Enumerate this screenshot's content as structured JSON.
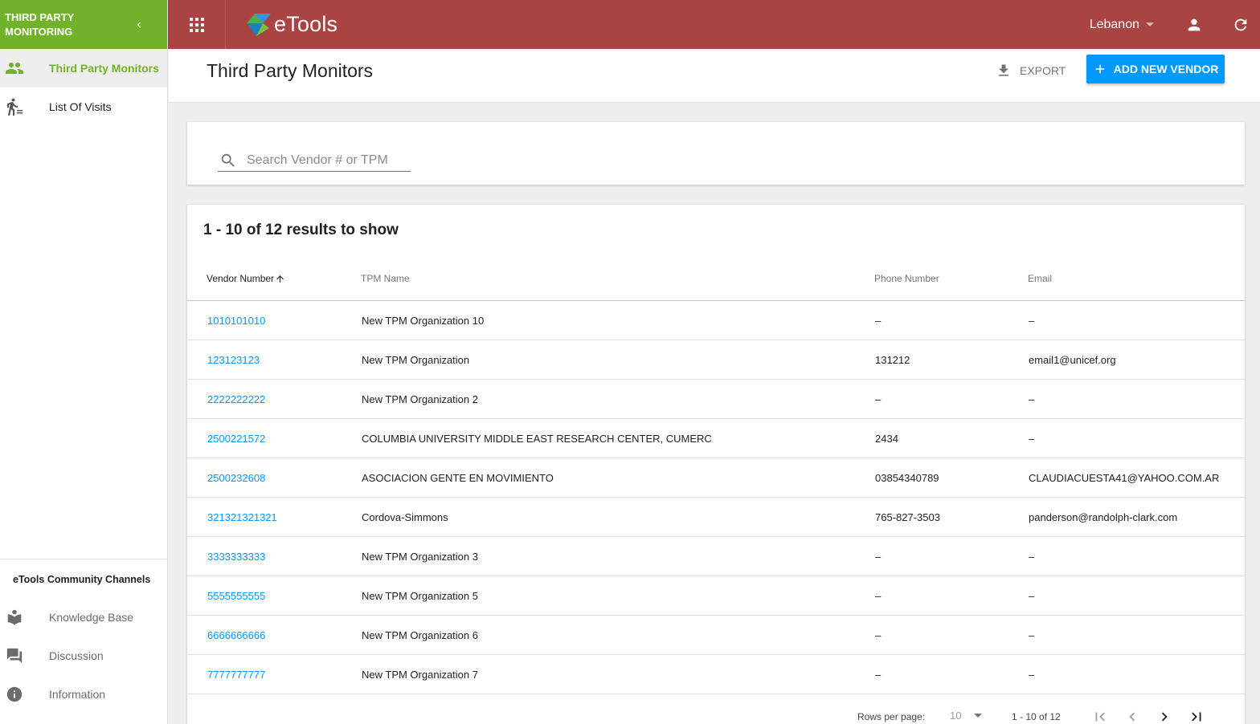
{
  "sidebar": {
    "app_title": "THIRD PARTY MONITORING",
    "items": [
      {
        "label": "Third Party Monitors",
        "icon": "people-icon"
      },
      {
        "label": "List Of Visits",
        "icon": "walking-icon"
      }
    ],
    "community_title": "eTools Community Channels",
    "community": [
      {
        "label": "Knowledge Base",
        "icon": "book-icon"
      },
      {
        "label": "Discussion",
        "icon": "chat-icon"
      },
      {
        "label": "Information",
        "icon": "info-icon"
      }
    ]
  },
  "topbar": {
    "logo_text": "eTools",
    "country": "Lebanon"
  },
  "page": {
    "title": "Third Party Monitors",
    "export_label": "EXPORT",
    "add_label": "ADD NEW VENDOR"
  },
  "search": {
    "placeholder": "Search Vendor # or TPM",
    "value": ""
  },
  "table": {
    "results_text": "1 - 10 of 12 results to show",
    "headers": [
      "Vendor Number",
      "TPM Name",
      "Phone Number",
      "Email"
    ],
    "rows": [
      [
        "1010101010",
        "New TPM Organization 10",
        "–",
        "–"
      ],
      [
        "123123123",
        "New TPM Organization",
        "131212",
        "email1@unicef.org"
      ],
      [
        "2222222222",
        "New TPM Organization 2",
        "–",
        "–"
      ],
      [
        "2500221572",
        "COLUMBIA UNIVERSITY MIDDLE EAST RESEARCH CENTER, CUMERC",
        "2434",
        "–"
      ],
      [
        "2500232608",
        "ASOCIACION GENTE EN MOVIMIENTO",
        "03854340789",
        "CLAUDIACUESTA41@YAHOO.COM.AR"
      ],
      [
        "321321321321",
        "Cordova-Simmons",
        "765-827-3503",
        "panderson@randolph-clark.com"
      ],
      [
        "3333333333",
        "New TPM Organization 3",
        "–",
        "–"
      ],
      [
        "5555555555",
        "New TPM Organization 5",
        "–",
        "–"
      ],
      [
        "6666666666",
        "New TPM Organization 6",
        "–",
        "–"
      ],
      [
        "7777777777",
        "New TPM Organization 7",
        "–",
        "–"
      ]
    ]
  },
  "pagination": {
    "rows_per_page_label": "Rows per page:",
    "rows_per_page": "10",
    "range": "1 - 10 of 12"
  },
  "colors": {
    "sidebar_header": "#72b22b",
    "topbar": "#a94442",
    "primary": "#0099ff"
  }
}
